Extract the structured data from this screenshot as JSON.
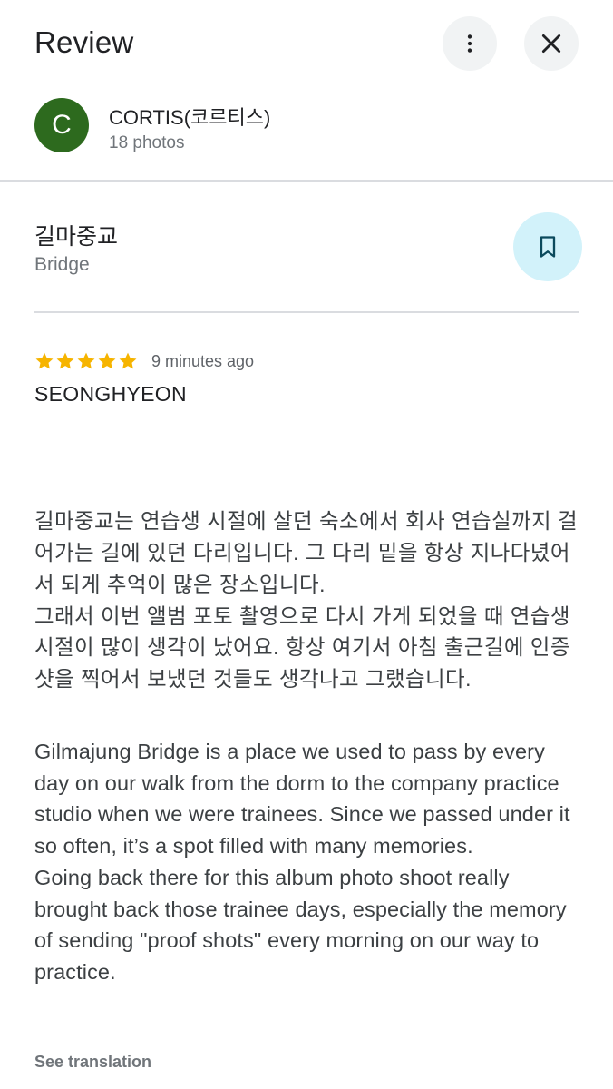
{
  "header": {
    "title": "Review",
    "more_icon": "more-vertical-icon",
    "close_icon": "close-icon"
  },
  "author": {
    "avatar_letter": "C",
    "avatar_color": "#2d6a1e",
    "name": "CORTIS(코르티스)",
    "photos": "18 photos"
  },
  "place": {
    "name": "길마중교",
    "type": "Bridge",
    "save_icon": "bookmark-icon",
    "save_bg": "#d2f2fa"
  },
  "review": {
    "rating": 5,
    "max_rating": 5,
    "star_color": "#f6b400",
    "time": "9 minutes ago",
    "reviewer": "SEONGHYEON",
    "text_korean": "길마중교는 연습생 시절에 살던 숙소에서 회사 연습실까지 걸어가는 길에 있던 다리입니다. 그 다리 밑을 항상 지나다녔어서 되게 추억이 많은 장소입니다.\n그래서 이번 앨범 포토 촬영으로 다시 가게 되었을 때 연습생 시절이 많이 생각이 났어요. 항상 여기서 아침 출근길에 인증샷을 찍어서 보냈던 것들도 생각나고 그랬습니다.",
    "text_english": "Gilmajung Bridge is a place we used to pass by every day on our walk from the dorm to the company practice studio when we were trainees. Since we passed under it so often, it’s a spot filled with many memories.\nGoing back there for this album photo shoot really brought back those trainee days, especially the memory of sending \"proof shots\" every morning on our way to practice.",
    "see_translation": "See translation"
  }
}
